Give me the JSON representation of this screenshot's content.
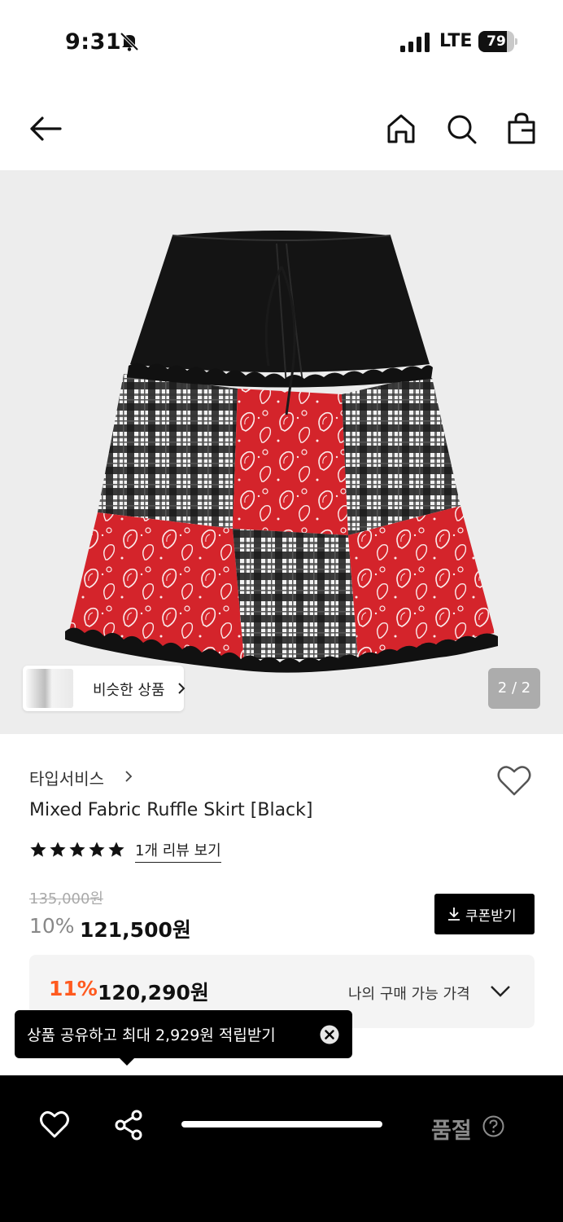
{
  "status_bar": {
    "time": "9:31",
    "network": "LTE",
    "battery": "79",
    "battery_level": 0.79
  },
  "nav": {
    "icons": [
      "back-arrow-icon",
      "home-icon",
      "search-icon",
      "shopping-bag-icon"
    ]
  },
  "gallery": {
    "similar_label": "비슷한 상품",
    "pager": "2 / 2"
  },
  "product": {
    "brand": "타입서비스",
    "title": "Mixed Fabric Ruffle Skirt [Black]",
    "rating": 5,
    "review_link": "1개 리뷰 보기",
    "original_price": "135,000원",
    "discount": "10%",
    "price": "121,500원",
    "coupon_label": "쿠폰받기"
  },
  "my_price": {
    "discount": "11%",
    "price": "120,290원",
    "label": "나의 구매 가능 가격"
  },
  "toast": {
    "text": "상품 공유하고 최대 2,929원 적립받기"
  },
  "bottom_bar": {
    "status": "품절"
  },
  "colors": {
    "accent_orange": "#ff5a1f",
    "skirt_red": "#d4242b",
    "black": "#000000"
  }
}
